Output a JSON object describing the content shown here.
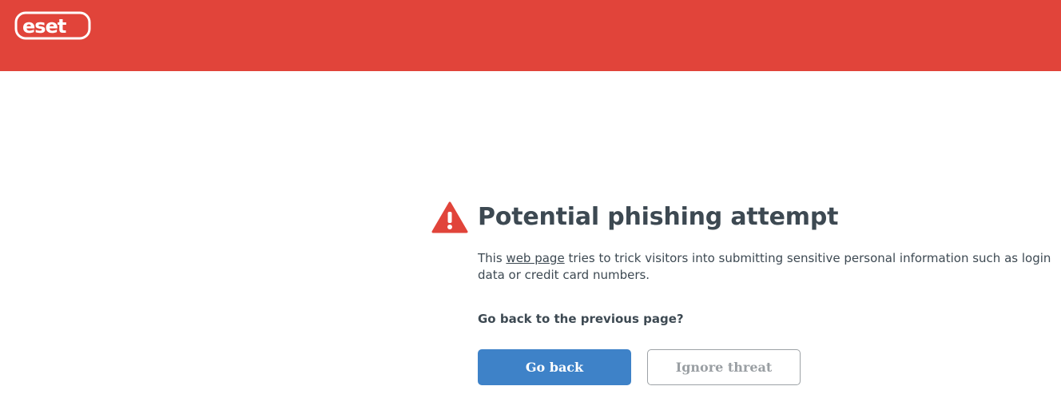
{
  "header": {
    "brand": "eset",
    "brand_color": "#e1443a",
    "logo_icon": "eset-logo"
  },
  "warning": {
    "icon": "warning-triangle-icon",
    "icon_color": "#e1443a",
    "title": "Potential phishing attempt",
    "desc_prefix": "This ",
    "desc_link": "web page",
    "desc_suffix": " tries to trick visitors into submitting sensitive personal information such as login data or credit card numbers.",
    "question": "Go back to the previous page?"
  },
  "actions": {
    "go_back_label": "Go back",
    "go_back_color": "#3e82c8",
    "ignore_label": "Ignore threat"
  }
}
